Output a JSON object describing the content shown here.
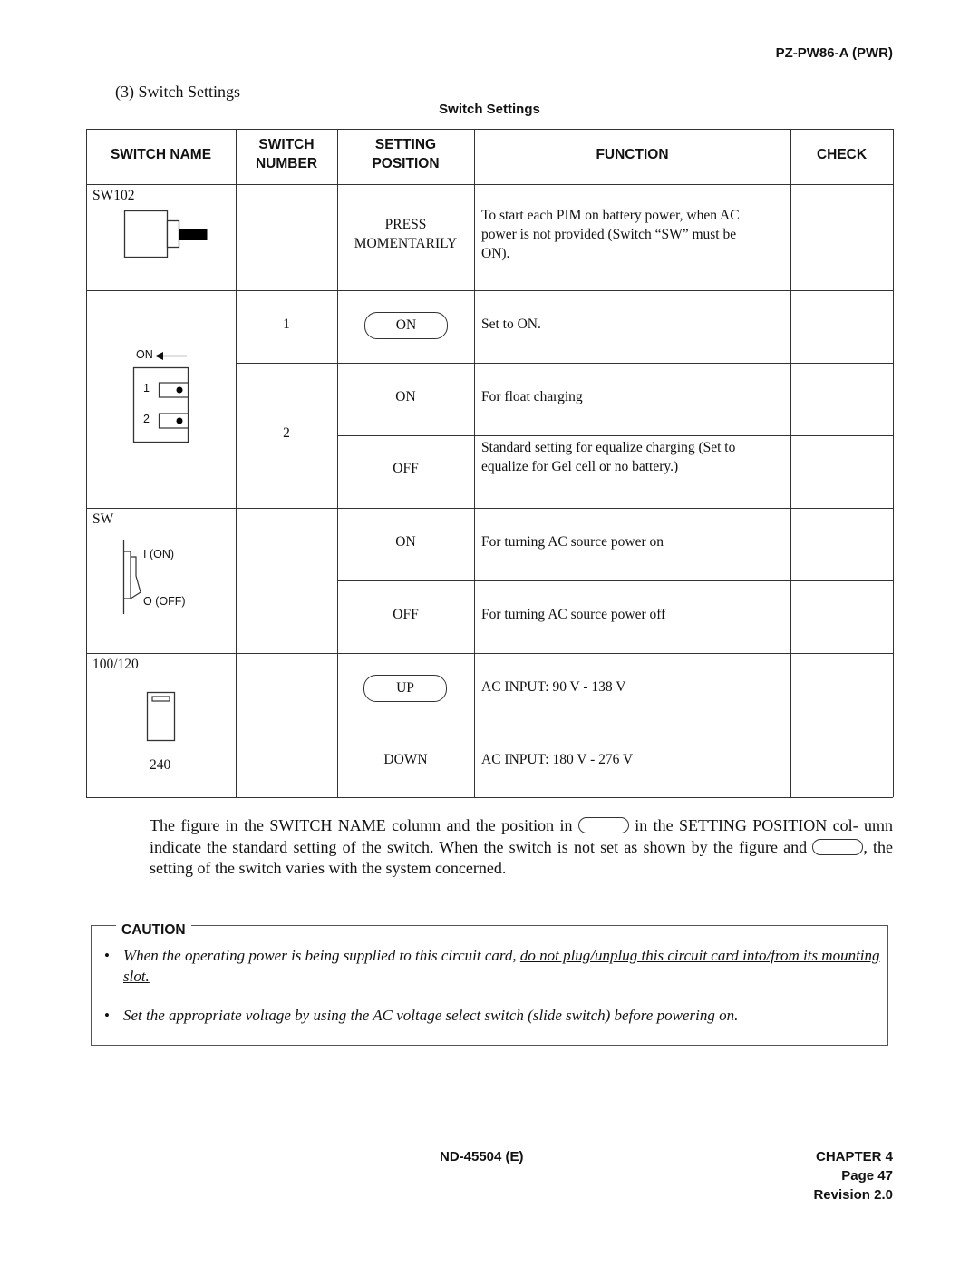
{
  "header": {
    "doc_id": "PZ-PW86-A (PWR)",
    "section_heading": "(3)  Switch Settings",
    "table_caption": "Switch Settings"
  },
  "table": {
    "columns": [
      "SWITCH NAME",
      "SWITCH",
      "NUMBER",
      "SETTING",
      "POSITION",
      "FUNCTION",
      "CHECK"
    ],
    "column_labels": {
      "switch_name": "SWITCH NAME",
      "switch_number": [
        "SWITCH",
        "NUMBER"
      ],
      "setting_position": [
        "SETTING",
        "POSITION"
      ],
      "function": "FUNCTION",
      "check": "CHECK"
    },
    "groups": [
      {
        "switch_name": "SW102",
        "figure_icon": "push-button-switch-icon",
        "rows": [
          {
            "switch_number": "",
            "setting": [
              "PRESS",
              "MOMENTARILY"
            ],
            "standard": false,
            "function": [
              "To start each PIM on battery power, when AC",
              "power is not provided (Switch “SW” must be",
              "ON)."
            ],
            "check": ""
          }
        ]
      },
      {
        "switch_name": "",
        "figure_icon": "dip-switch-icon",
        "figure_labels": {
          "on_arrow": "ON",
          "pos1": "1",
          "pos2": "2"
        },
        "rows": [
          {
            "switch_number": "1",
            "setting": "ON",
            "standard": true,
            "function": "Set to ON.",
            "check": ""
          },
          {
            "switch_number": "2",
            "setting": "ON",
            "standard": false,
            "function": "For float charging",
            "check": ""
          },
          {
            "switch_number": "",
            "setting": "OFF",
            "standard": false,
            "function": [
              "Standard setting for equalize charging (Set to",
              "equalize for Gel cell or no battery.)"
            ],
            "check": ""
          }
        ]
      },
      {
        "switch_name": "SW",
        "figure_icon": "rocker-switch-icon",
        "figure_labels": {
          "on": "I (ON)",
          "off": "O (OFF)"
        },
        "rows": [
          {
            "switch_number": "",
            "setting": "ON",
            "standard": false,
            "function": "For turning AC source power on",
            "check": ""
          },
          {
            "switch_number": "",
            "setting": "OFF",
            "standard": false,
            "function": "For turning AC source power off",
            "check": ""
          }
        ]
      },
      {
        "switch_name": "100/120",
        "switch_name_bottom": "240",
        "figure_icon": "slide-switch-icon",
        "rows": [
          {
            "switch_number": "",
            "setting": "UP",
            "standard": true,
            "function": "AC INPUT:  90 V - 138 V",
            "check": ""
          },
          {
            "switch_number": "",
            "setting": "DOWN",
            "standard": false,
            "function": "AC INPUT:  180 V - 276 V",
            "check": ""
          }
        ]
      }
    ]
  },
  "note": {
    "part1": "The figure in the SWITCH NAME column and the position in ",
    "part2": " in the SETTING POSITION col- umn indicate the standard setting of the switch. When the switch is not set as shown by the figure and ",
    "part3": ", the setting of the switch varies with the system concerned."
  },
  "caution": {
    "label": "CAUTION",
    "items": [
      {
        "text_plain": "When the operating power is being supplied to this circuit card, ",
        "text_underlined": "do not plug/unplug this circuit card into/from its mounting slot."
      },
      {
        "text_plain": "Set the appropriate voltage by using the AC voltage select switch (slide switch) before powering on.",
        "text_underlined": ""
      }
    ]
  },
  "footer": {
    "doc_number": "ND-45504 (E)",
    "chapter": "CHAPTER 4",
    "page": "Page 47",
    "revision": "Revision 2.0"
  }
}
